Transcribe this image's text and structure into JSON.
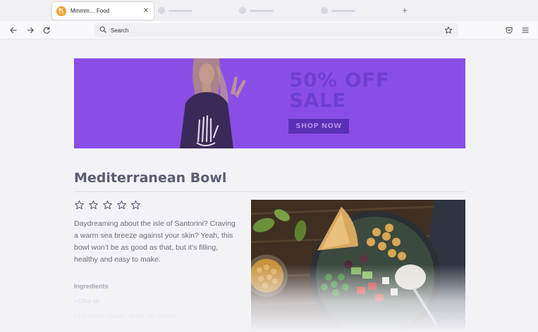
{
  "browser": {
    "tab": {
      "title": "Mmmm… Food",
      "favicon": "food-favicon"
    },
    "url_placeholder": "Search",
    "icons": {
      "back": "arrow-left-icon",
      "forward": "arrow-right-icon",
      "reload": "reload-icon",
      "search": "search-icon",
      "bookmark": "star-icon",
      "pocket": "pocket-icon",
      "menu": "hamburger-menu-icon",
      "new_tab": "plus-icon",
      "close_tab": "close-icon"
    }
  },
  "banner": {
    "headline_line1": "50% OFF",
    "headline_line2": "SALE",
    "cta": "SHOP NOW",
    "background": "#8a4ee6"
  },
  "recipe": {
    "title": "Mediterranean Bowl",
    "rating": {
      "filled": 0,
      "max": 5
    },
    "description": "Daydreaming about the isle of Santorini? Craving a warm sea breeze against your skin? Yeah, this bowl won’t be as good as that, but it’s filling, healthy and easy to make.",
    "ingredients_heading": "Ingredients",
    "ingredients": [
      "• Olive oil",
      "• 1 zucchini squash, sliced into rounds"
    ]
  }
}
